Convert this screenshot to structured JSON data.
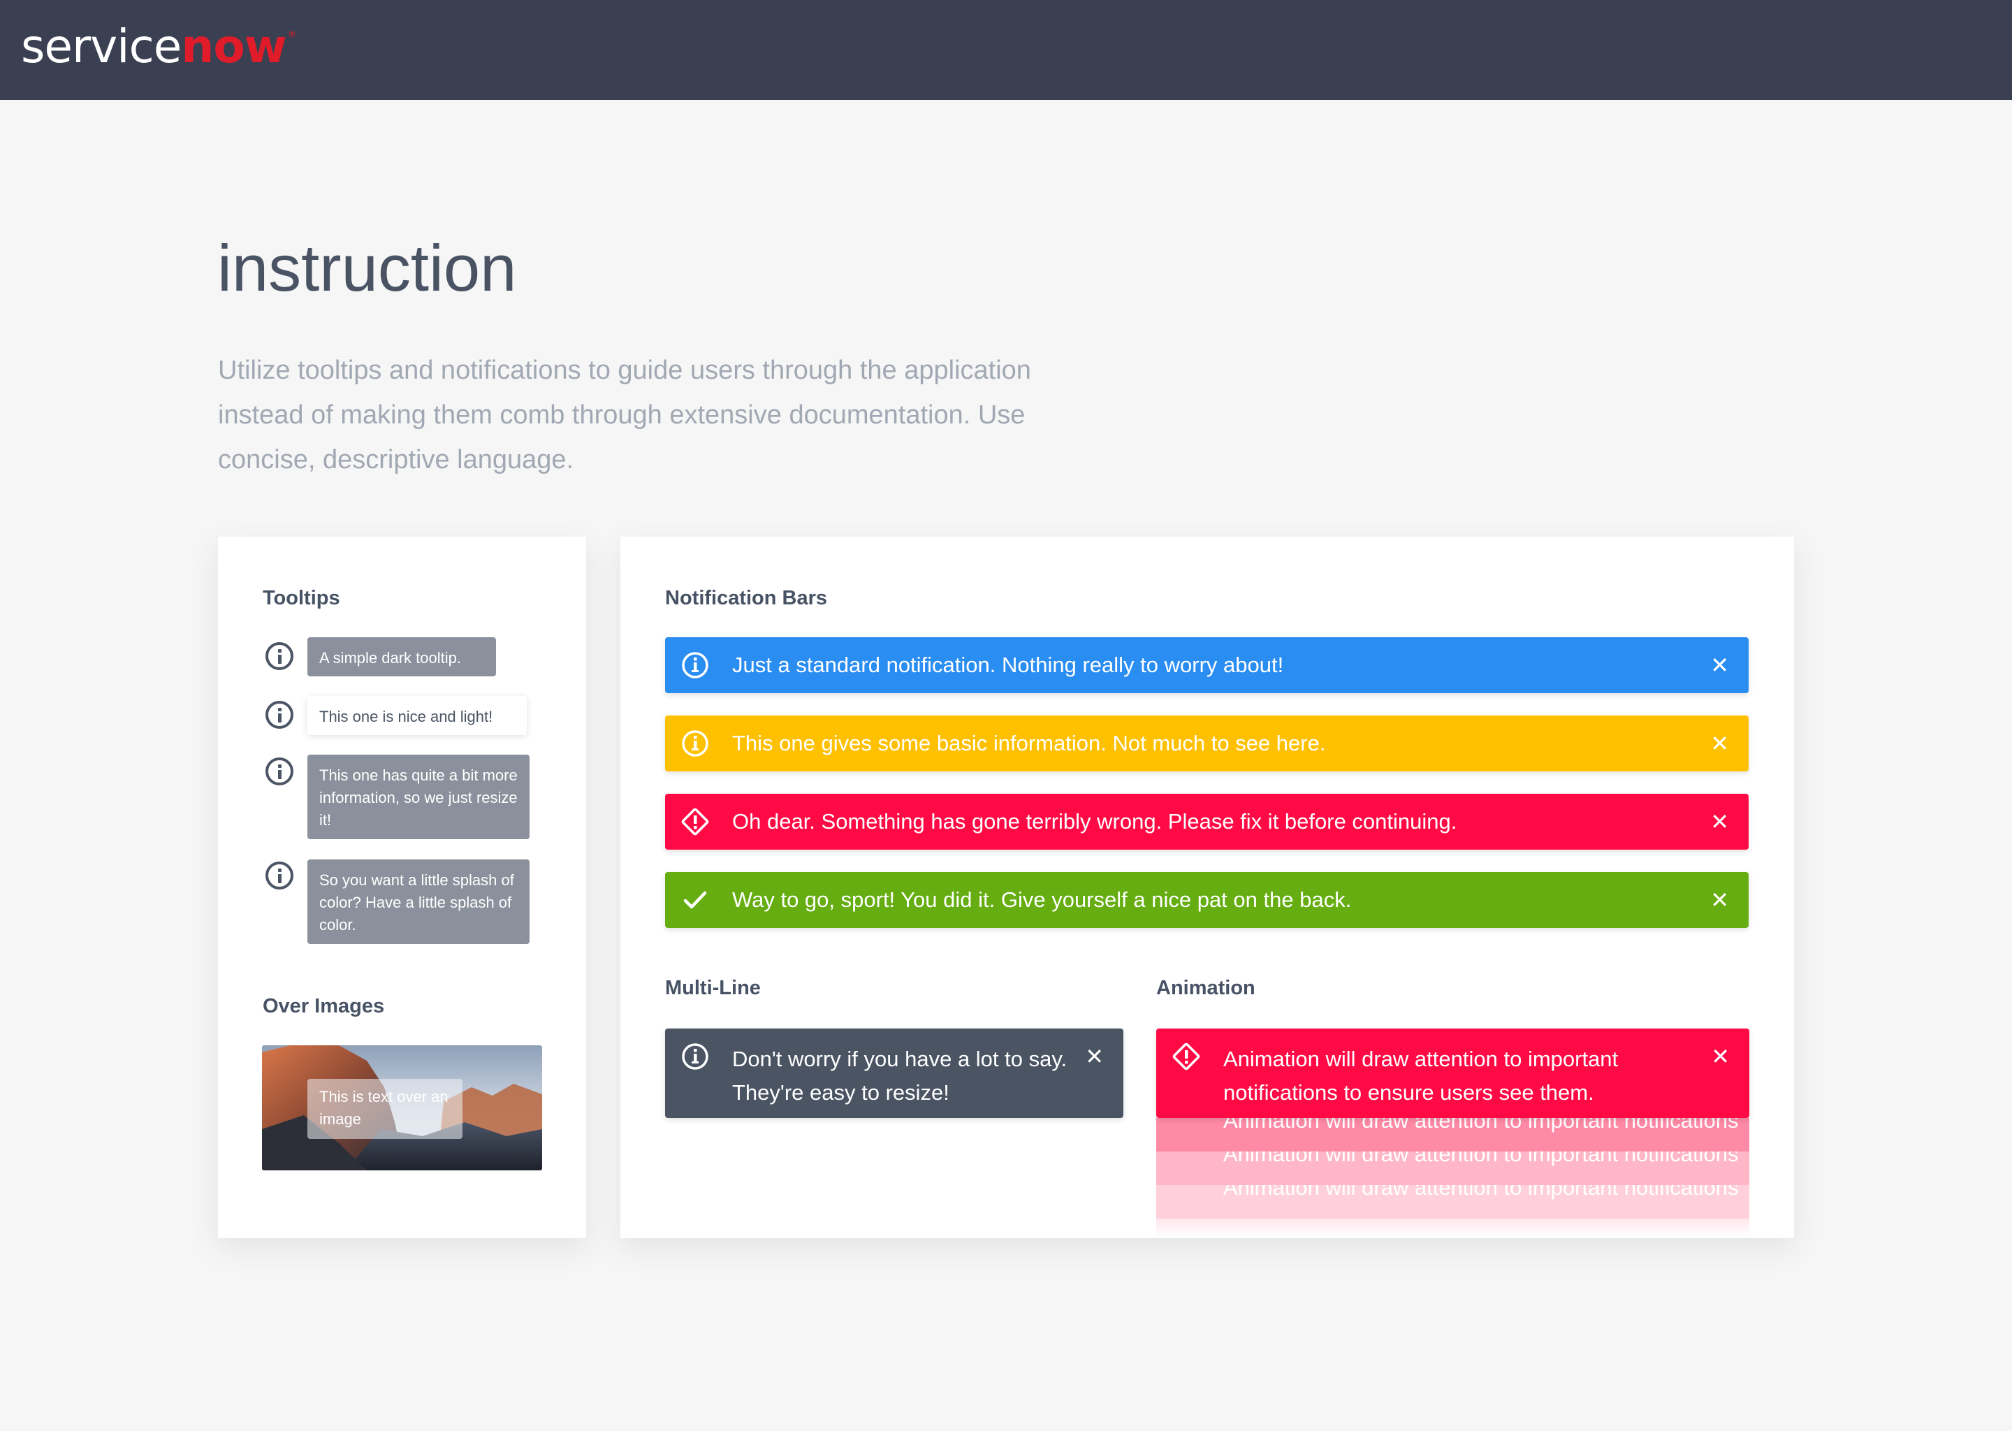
{
  "brand": {
    "part1": "service",
    "part2": "now",
    "trademark": "®"
  },
  "page": {
    "title": "instruction",
    "intro": "Utilize tooltips and notifications to guide users through the application instead of making them comb through extensive documentation. Use concise, descriptive language."
  },
  "tooltips": {
    "title": "Tooltips",
    "items": [
      {
        "text": "A simple dark tooltip.",
        "style": "dark",
        "icon": "info-icon"
      },
      {
        "text": "This one is nice and light!",
        "style": "light",
        "icon": "info-icon"
      },
      {
        "text": "This one has quite a bit more information, so we just resize it!",
        "style": "dark",
        "icon": "info-icon"
      },
      {
        "text": "So you want a little splash of color? Have a little splash of color.",
        "style": "dark",
        "icon": "info-icon"
      }
    ]
  },
  "over_images": {
    "title": "Over Images",
    "tooltip": "This is text over an image"
  },
  "notification_bars": {
    "title": "Notification Bars",
    "close_label": "✕",
    "items": [
      {
        "text": "Just a standard notification. Nothing really to worry about!",
        "color": "#2a8df2",
        "icon": "info-icon"
      },
      {
        "text": "This one gives some basic information. Not much to see here.",
        "color": "#ffc000",
        "icon": "info-icon"
      },
      {
        "text": "Oh dear. Something has gone terribly wrong. Please fix it before continuing.",
        "color": "#ff0a45",
        "icon": "warning-diamond-icon"
      },
      {
        "text": "Way to go, sport! You did it. Give yourself a nice pat on the back.",
        "color": "#65ad10",
        "icon": "checkmark-icon"
      }
    ]
  },
  "multi_line": {
    "title": "Multi-Line",
    "text_line1": "Don't worry if you have a lot to say.",
    "text_line2": "They're easy to resize!",
    "color": "#4a5463"
  },
  "animation": {
    "title": "Animation",
    "text_line1": "Animation will draw attention to important",
    "text_line2": "notifications to ensure users see them.",
    "ghost_text": "Animation will draw attention to important notifications",
    "color": "#ff0a45"
  }
}
